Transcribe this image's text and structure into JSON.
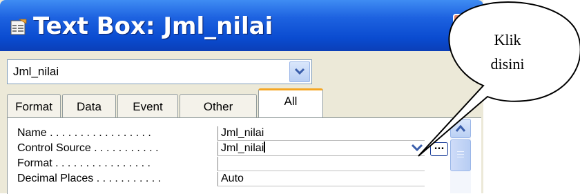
{
  "window": {
    "title": "Text Box: Jml_nilai",
    "close_glyph": "X"
  },
  "object_selector": {
    "selected": "Jml_nilai"
  },
  "tabs": [
    {
      "label": "Format",
      "active": false
    },
    {
      "label": "Data",
      "active": false
    },
    {
      "label": "Event",
      "active": false
    },
    {
      "label": "Other",
      "active": false
    },
    {
      "label": "All",
      "active": true
    }
  ],
  "properties": [
    {
      "label": "Name . . . . . . . . . . . . . . . . .",
      "value": "Jml_nilai"
    },
    {
      "label": "Control Source . . . . . . . . . . .",
      "value": "Jml_nilai"
    },
    {
      "label": "Format . . . . . . . . . . . . . . . .",
      "value": ""
    },
    {
      "label": "Decimal Places . . . . . . . . . . .",
      "value": "Auto"
    }
  ],
  "controls": {
    "build_button_label": "...",
    "dropdown_icon": "chevron-down-icon",
    "scroll_up_icon": "chevron-up-icon"
  },
  "callout": {
    "line1": "Klik",
    "line2": "disini"
  },
  "colors": {
    "titlebar": "#0a4bd0",
    "dialog_bg": "#ece9d8",
    "active_tab_accent": "#f5a623",
    "close_button": "#c9442b"
  }
}
